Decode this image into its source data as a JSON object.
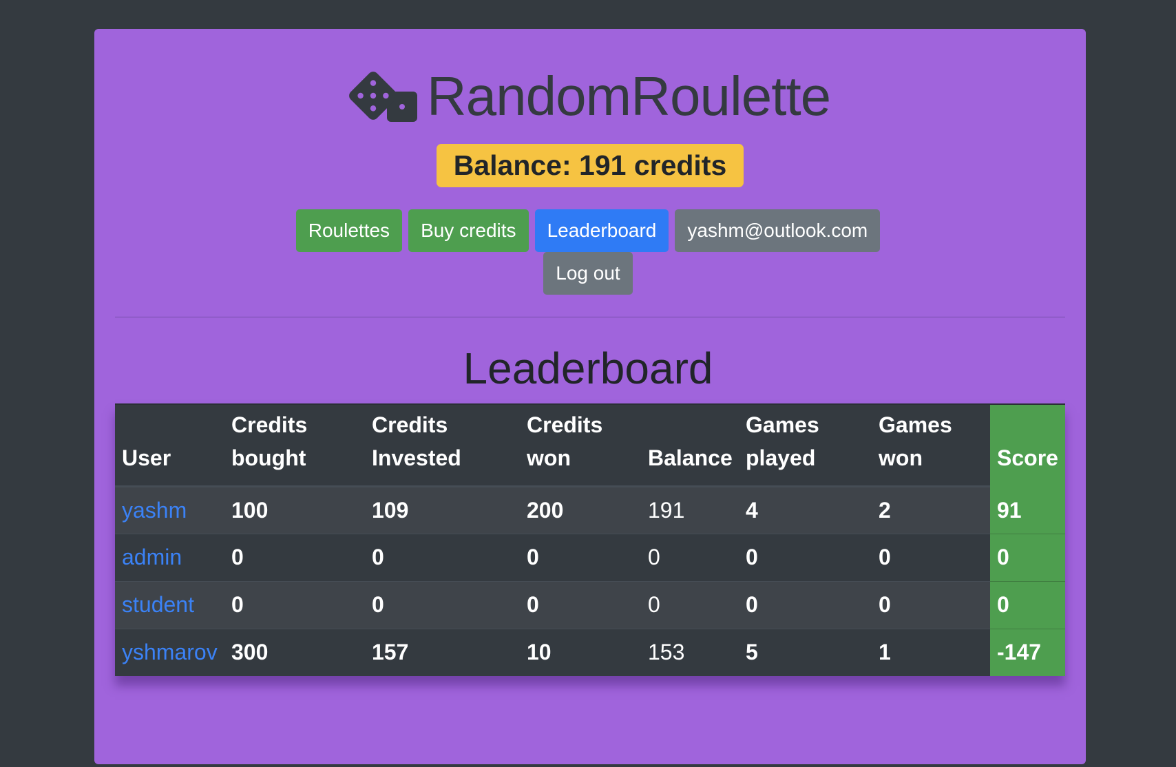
{
  "app": {
    "title": "RandomRoulette",
    "icon": "dice-icon"
  },
  "balance": {
    "text": "Balance: 191 credits"
  },
  "nav": {
    "roulettes": "Roulettes",
    "buy_credits": "Buy credits",
    "leaderboard": "Leaderboard",
    "user_email": "yashm@outlook.com",
    "log_out": "Log out"
  },
  "page": {
    "heading": "Leaderboard"
  },
  "table": {
    "headers": {
      "user": "User",
      "credits_bought": "Credits bought",
      "credits_invested": "Credits Invested",
      "credits_won": "Credits won",
      "balance": "Balance",
      "games_played": "Games played",
      "games_won": "Games won",
      "score": "Score"
    },
    "rows": [
      {
        "user": "yashm",
        "credits_bought": "100",
        "credits_invested": "109",
        "credits_won": "200",
        "balance": "191",
        "games_played": "4",
        "games_won": "2",
        "score": "91"
      },
      {
        "user": "admin",
        "credits_bought": "0",
        "credits_invested": "0",
        "credits_won": "0",
        "balance": "0",
        "games_played": "0",
        "games_won": "0",
        "score": "0"
      },
      {
        "user": "student",
        "credits_bought": "0",
        "credits_invested": "0",
        "credits_won": "0",
        "balance": "0",
        "games_played": "0",
        "games_won": "0",
        "score": "0"
      },
      {
        "user": "yshmarov",
        "credits_bought": "300",
        "credits_invested": "157",
        "credits_won": "10",
        "balance": "153",
        "games_played": "5",
        "games_won": "1",
        "score": "-147"
      }
    ]
  },
  "colors": {
    "page_bg": "#343a40",
    "card_bg": "#a064dc",
    "balance_badge": "#f6c342",
    "success": "#4e9e4f",
    "primary": "#2f7bf5",
    "secondary": "#6c757d",
    "link": "#3b82f6"
  }
}
